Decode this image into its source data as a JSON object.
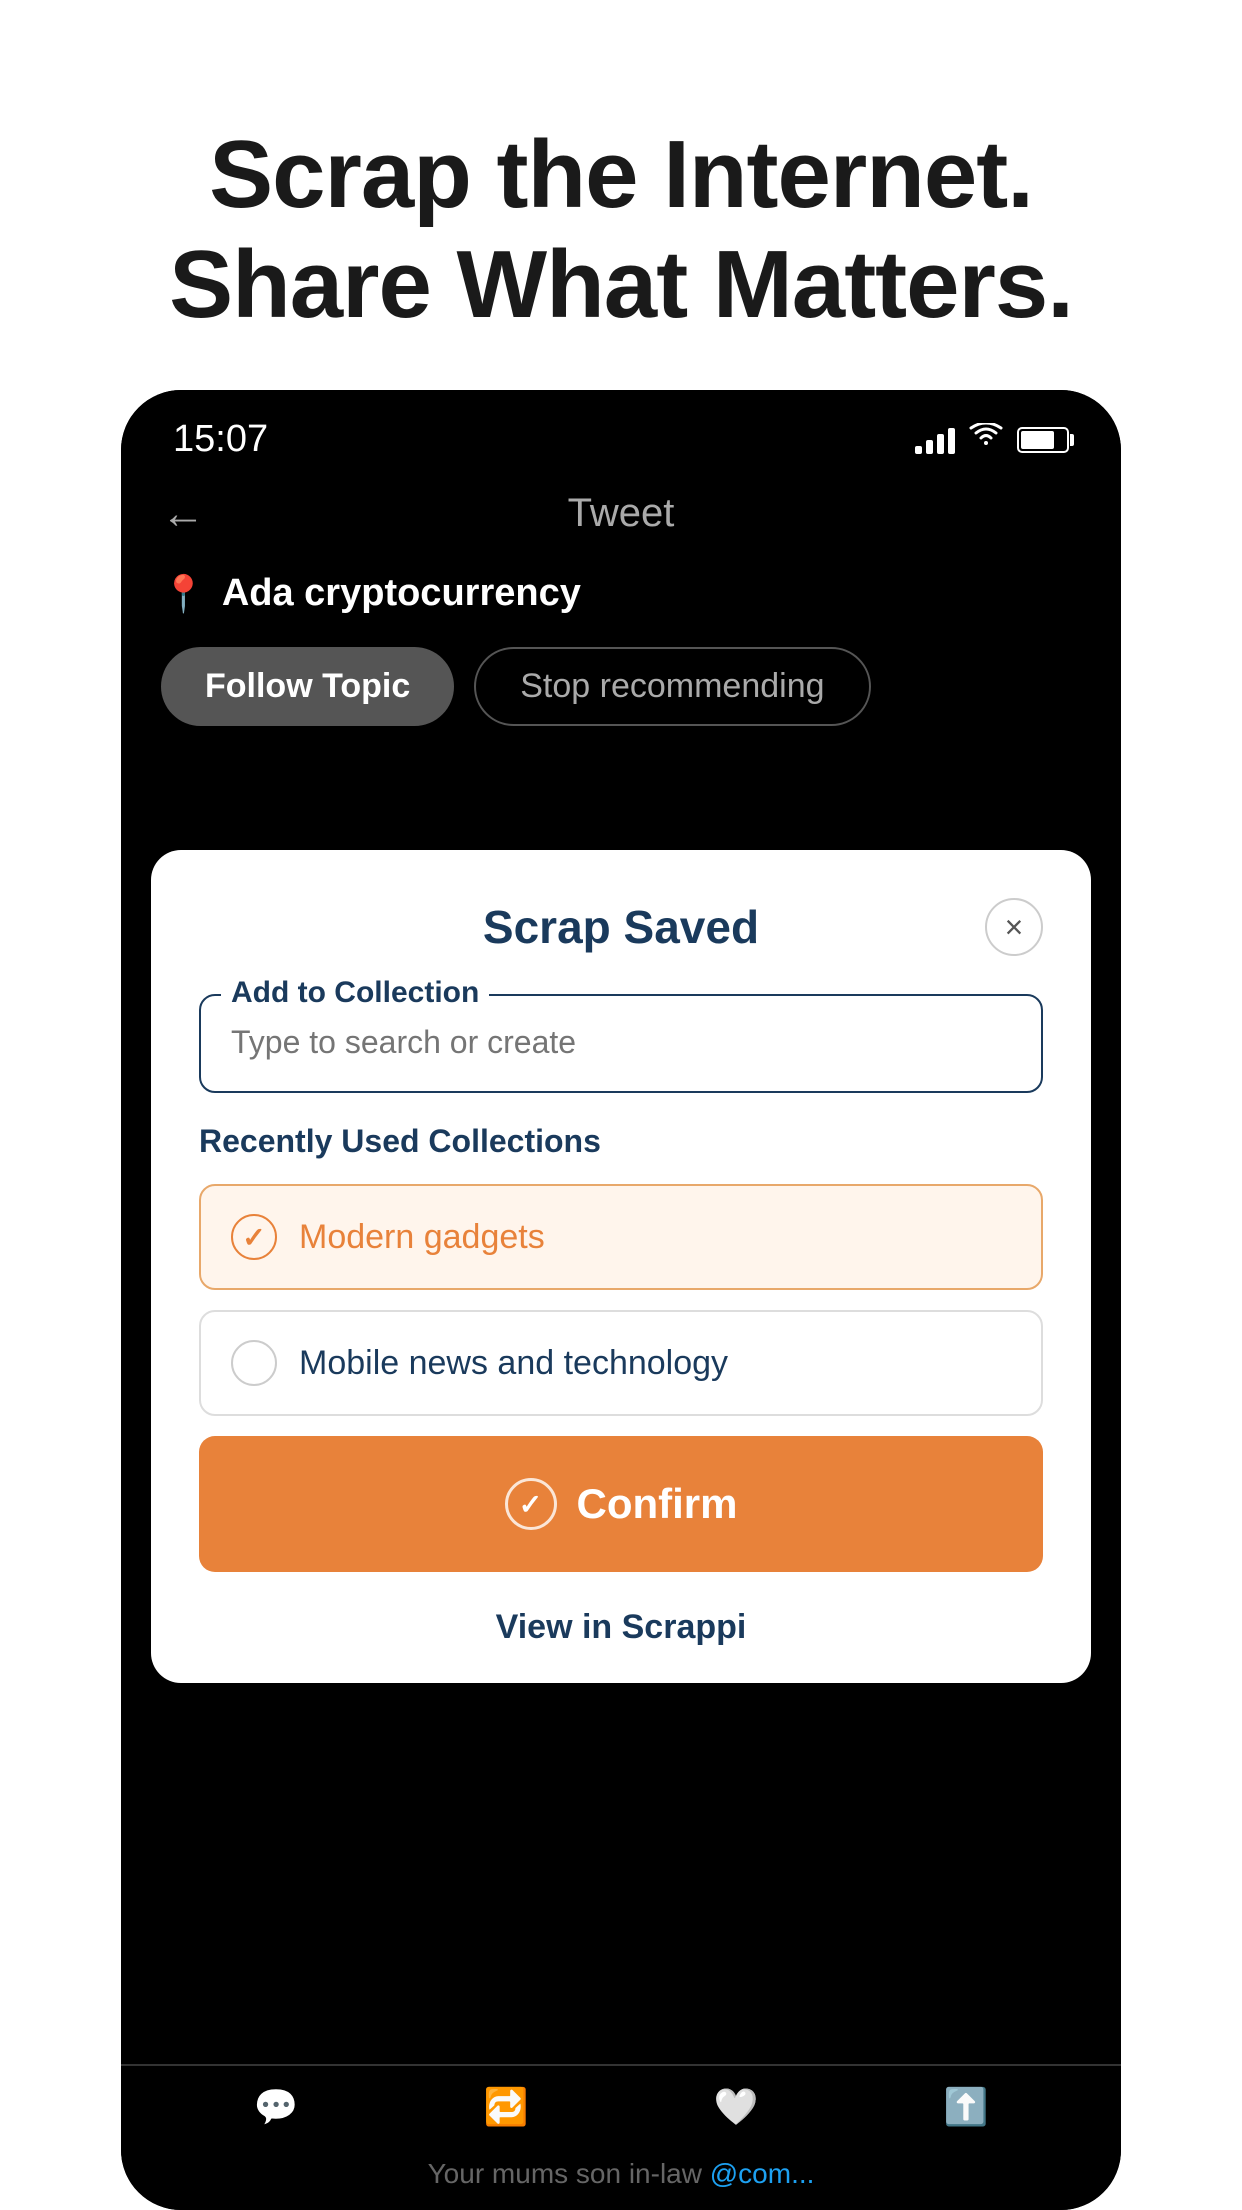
{
  "page": {
    "background": "#ffffff"
  },
  "headline": {
    "line1": "Scrap the Internet.",
    "line2": "Share What Matters."
  },
  "status_bar": {
    "time": "15:07",
    "signal_label": "signal",
    "wifi_label": "wifi",
    "battery_label": "battery"
  },
  "tweet_header": {
    "back_label": "←",
    "title": "Tweet"
  },
  "topic": {
    "pin_icon": "📍",
    "name": "Ada cryptocurrency"
  },
  "topic_actions": {
    "follow_label": "Follow Topic",
    "stop_label": "Stop recommending"
  },
  "modal": {
    "title": "Scrap Saved",
    "close_label": "×",
    "add_to_collection_label": "Add to Collection",
    "search_placeholder": "Type to search or create",
    "recently_used_label": "Recently Used Collections",
    "collections": [
      {
        "id": "modern-gadgets",
        "name": "Modern gadgets",
        "selected": true
      },
      {
        "id": "mobile-news",
        "name": "Mobile news and technology",
        "selected": false
      }
    ],
    "confirm_label": "Confirm",
    "view_label": "View in Scrappi"
  },
  "colors": {
    "orange": "#e8823a",
    "dark_blue": "#1a3a5c",
    "selected_bg": "#fff5ec",
    "selected_border": "#e8a86a"
  }
}
